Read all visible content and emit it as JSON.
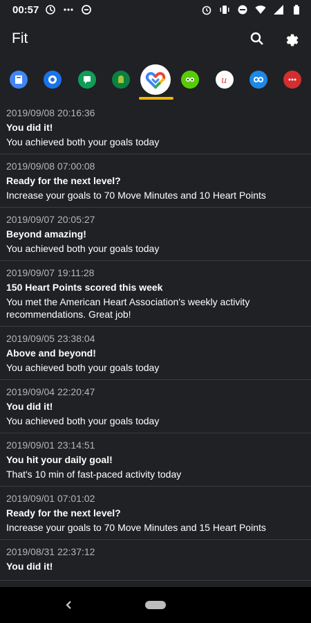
{
  "status_bar": {
    "time": "00:57"
  },
  "app_bar": {
    "title": "Fit"
  },
  "app_icons": [
    {
      "name": "app-icon-1",
      "color": "#4285f4"
    },
    {
      "name": "app-icon-2",
      "color": "#1a73e8"
    },
    {
      "name": "app-icon-3",
      "color": "#0f9d58"
    },
    {
      "name": "app-icon-4",
      "color": "#0b8043"
    },
    {
      "name": "google-fit",
      "color": "#ffffff",
      "selected": true
    },
    {
      "name": "duolingo",
      "color": "#58cc02"
    },
    {
      "name": "app-icon-u",
      "color": "#e53935"
    },
    {
      "name": "app-icon-infinity",
      "color": "#1e88e5"
    },
    {
      "name": "app-icon-dots",
      "color": "#d32f2f"
    }
  ],
  "notifications": [
    {
      "timestamp": "2019/09/08 20:16:36",
      "title": "You did it!",
      "body": "You achieved both your goals today"
    },
    {
      "timestamp": "2019/09/08 07:00:08",
      "title": "Ready for the next level?",
      "body": "Increase your goals to 70 Move Minutes and 10 Heart Points"
    },
    {
      "timestamp": "2019/09/07 20:05:27",
      "title": "Beyond amazing!",
      "body": "You achieved both your goals today"
    },
    {
      "timestamp": "2019/09/07 19:11:28",
      "title": "150 Heart Points scored this week",
      "body": "You met the American Heart Association's weekly activity recommendations. Great job!"
    },
    {
      "timestamp": "2019/09/05 23:38:04",
      "title": "Above and beyond!",
      "body": "You achieved both your goals today"
    },
    {
      "timestamp": "2019/09/04 22:20:47",
      "title": "You did it!",
      "body": "You achieved both your goals today"
    },
    {
      "timestamp": "2019/09/01 23:14:51",
      "title": "You hit your daily goal!",
      "body": "That's 10 min of fast-paced activity today"
    },
    {
      "timestamp": "2019/09/01 07:01:02",
      "title": "Ready for the next level?",
      "body": "Increase your goals to 70 Move Minutes and 15 Heart Points"
    },
    {
      "timestamp": "2019/08/31 22:37:12",
      "title": "You did it!",
      "body": ""
    }
  ],
  "colors": {
    "background": "#202124",
    "accent_underline": "#f4b400",
    "timestamp": "#b4b6ba",
    "divider": "#3c3d40"
  }
}
